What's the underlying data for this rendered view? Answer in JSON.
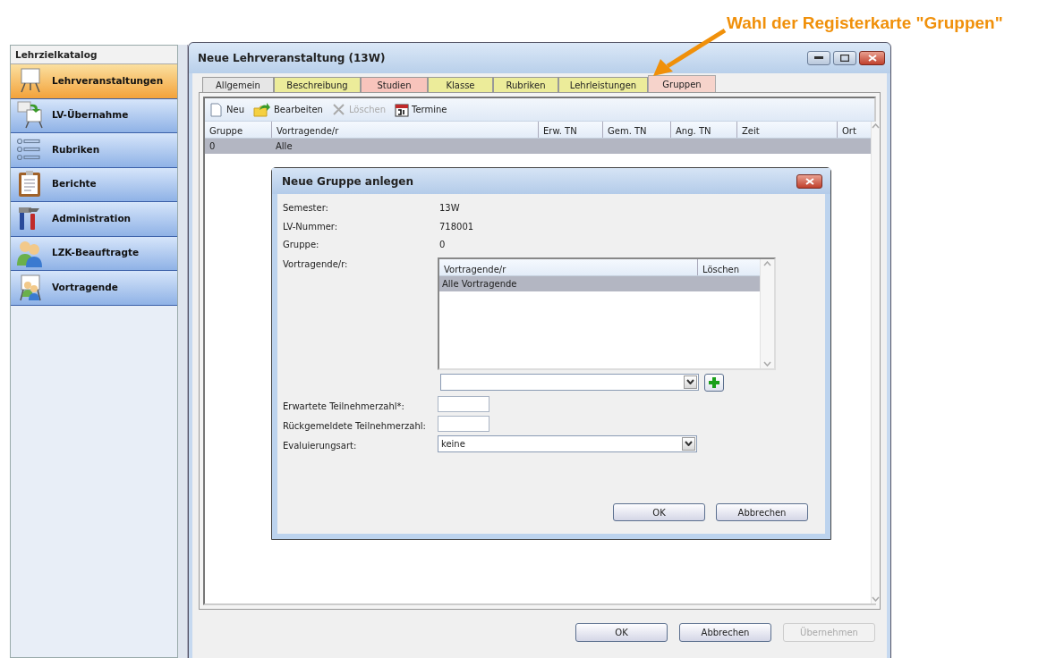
{
  "annotation": {
    "text": "Wahl der Registerkarte \"Gruppen\""
  },
  "sidebar": {
    "title": "Lehrzielkatalog",
    "items": [
      {
        "label": "Lehrveranstaltungen",
        "selected": true,
        "kind": "easel"
      },
      {
        "label": "LV-Übernahme",
        "selected": false,
        "kind": "transfer"
      },
      {
        "label": "Rubriken",
        "selected": false,
        "kind": "list"
      },
      {
        "label": "Berichte",
        "selected": false,
        "kind": "clipboard"
      },
      {
        "label": "Administration",
        "selected": false,
        "kind": "tools"
      },
      {
        "label": "LZK-Beauftragte",
        "selected": false,
        "kind": "people"
      },
      {
        "label": "Vortragende",
        "selected": false,
        "kind": "presenter"
      }
    ]
  },
  "window": {
    "title": "Neue Lehrveranstaltung (13W)",
    "tabs": [
      {
        "label": "Allgemein",
        "color": "#e6e6e6",
        "selected": false
      },
      {
        "label": "Beschreibung",
        "color": "#ecec9a",
        "selected": false
      },
      {
        "label": "Studien",
        "color": "#f8c4bc",
        "selected": false
      },
      {
        "label": "Klasse",
        "color": "#ecec9a",
        "selected": false
      },
      {
        "label": "Rubriken",
        "color": "#ecec9a",
        "selected": false
      },
      {
        "label": "Lehrleistungen",
        "color": "#ecec9a",
        "selected": false
      },
      {
        "label": "Gruppen",
        "color": "#f6d3cb",
        "selected": true
      }
    ],
    "toolbar": [
      {
        "label": "Neu",
        "kind": "new",
        "disabled": false
      },
      {
        "label": "Bearbeiten",
        "kind": "edit",
        "disabled": false
      },
      {
        "label": "Löschen",
        "kind": "delete",
        "disabled": true
      },
      {
        "label": "Termine",
        "kind": "calendar",
        "disabled": false
      }
    ],
    "table": {
      "columns": [
        "Gruppe",
        "Vortragende/r",
        "Erw. TN",
        "Gem. TN",
        "Ang. TN",
        "Zeit",
        "Ort"
      ],
      "rows": [
        {
          "cells": [
            "0",
            "Alle"
          ],
          "selected": true
        }
      ]
    },
    "buttons": [
      {
        "label": "OK",
        "disabled": false
      },
      {
        "label": "Abbrechen",
        "disabled": false
      },
      {
        "label": "Übernehmen",
        "disabled": true
      }
    ]
  },
  "dialog": {
    "title": "Neue Gruppe anlegen",
    "fields": [
      {
        "label": "Semester:",
        "value": "13W"
      },
      {
        "label": "LV-Nummer:",
        "value": "718001"
      },
      {
        "label": "Gruppe:",
        "value": "0"
      }
    ],
    "lecturers": {
      "label": "Vortragende/r:",
      "columns": [
        "Vortragende/r",
        "Löschen"
      ],
      "rows": [
        {
          "cells": [
            "Alle Vortragende"
          ],
          "selected": true
        }
      ]
    },
    "inputs": [
      {
        "label": "Erwartete Teilnehmerzahl*:"
      },
      {
        "label": "Rückgemeldete Teilnehmerzahl:"
      }
    ],
    "evaluation": {
      "label": "Evaluierungsart:",
      "value": "keine"
    },
    "buttons": [
      {
        "label": "OK",
        "disabled": false
      },
      {
        "label": "Abbrechen",
        "disabled": false
      }
    ]
  }
}
